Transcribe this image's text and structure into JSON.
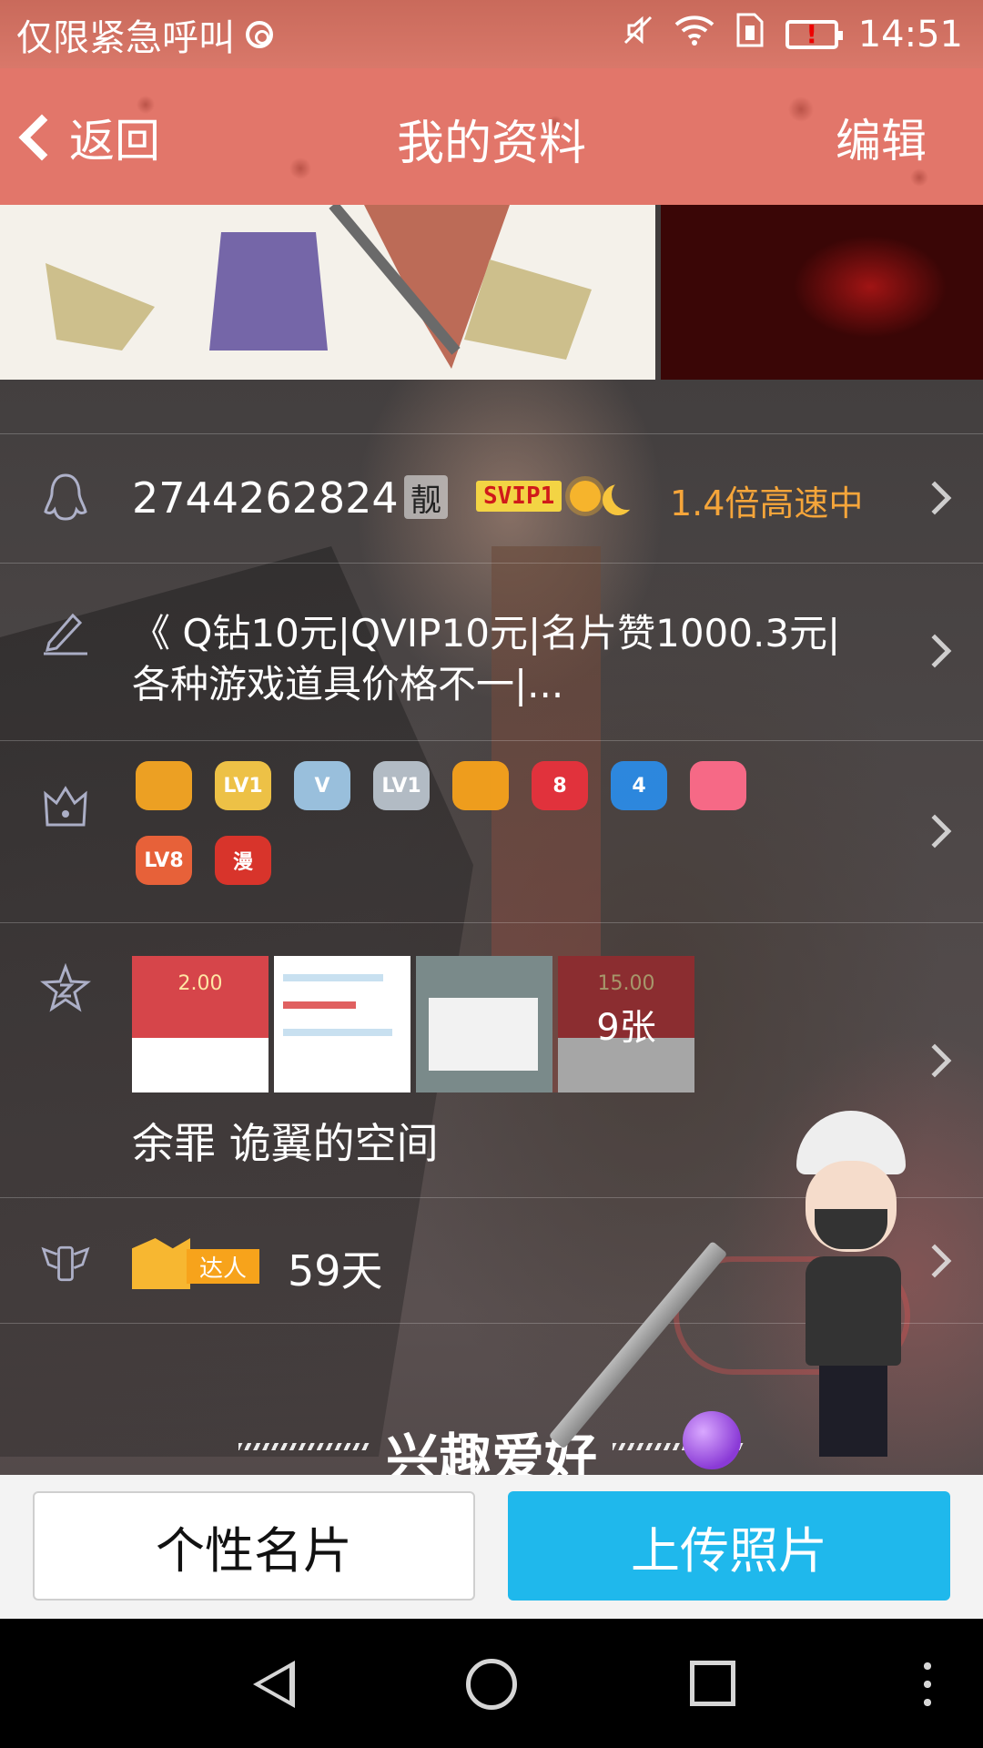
{
  "status_bar": {
    "carrier_text": "仅限紧急呼叫",
    "time": "14:51",
    "battery_alert": "!",
    "icons": [
      "location-ring-icon",
      "mute-icon",
      "wifi-icon",
      "sim-icon",
      "battery-icon"
    ]
  },
  "header": {
    "back_label": "返回",
    "title": "我的资料",
    "edit_label": "编辑"
  },
  "profile": {
    "qq_number": "2744262824",
    "liang_badge": "靓",
    "svip_badge": "SVIP1",
    "speed_text": "1.4倍高速中",
    "signature": "《 Q钻10元|QVIP10元|名片赞1000.3元|各种游戏道具价格不一|...",
    "medals": [
      {
        "name": "qq-penguin-medal",
        "label": "",
        "color": "#f5a623"
      },
      {
        "name": "diamond-lv1-medal",
        "label": "LV1",
        "color": "#f7c948"
      },
      {
        "name": "cloud-v-medal",
        "label": "V",
        "color": "#9ec7e6"
      },
      {
        "name": "silver-lv1-medal",
        "label": "LV1",
        "color": "#b8c3cc"
      },
      {
        "name": "book-medal",
        "label": "",
        "color": "#f7a21b"
      },
      {
        "name": "ruby-8-medal",
        "label": "8",
        "color": "#e8323c"
      },
      {
        "name": "star-4-medal",
        "label": "4",
        "color": "#2b8be6"
      },
      {
        "name": "pink-gem-medal",
        "label": "",
        "color": "#ff6b8a"
      },
      {
        "name": "flash-lv8-medal",
        "label": "LV8",
        "color": "#f0643a"
      },
      {
        "name": "manga-medal",
        "label": "漫",
        "color": "#e0352b"
      }
    ],
    "album": {
      "count_label": "9张",
      "thumbs": [
        {
          "type": "redpacket",
          "amount": "2.00"
        },
        {
          "type": "screenshot"
        },
        {
          "type": "dialog"
        },
        {
          "type": "redpacket",
          "amount": "15.00"
        }
      ]
    },
    "space_name": "余罪   诡翼的空间",
    "expert_tag": "达人",
    "days": "59天",
    "section_title": "兴趣爱好"
  },
  "actions": {
    "card_label": "个性名片",
    "upload_label": "上传照片"
  },
  "colors": {
    "header": "#e2766a",
    "accent_blue": "#1fb8ec",
    "speed_orange": "#f5a53a"
  }
}
